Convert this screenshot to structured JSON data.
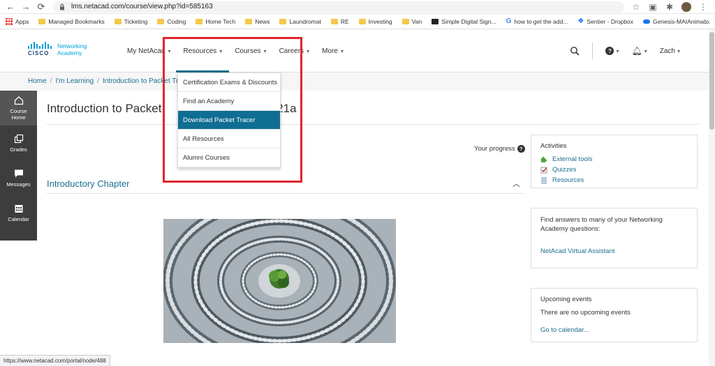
{
  "browser": {
    "url": "lms.netacad.com/course/view.php?id=585163",
    "status_url": "https://www.netacad.com/portal/node/488",
    "bookmarks": [
      {
        "label": "Apps",
        "icon": "apps-grid-icon"
      },
      {
        "label": "Managed Bookmarks",
        "icon": "folder-icon"
      },
      {
        "label": "Ticketing",
        "icon": "folder-icon"
      },
      {
        "label": "Coding",
        "icon": "folder-icon"
      },
      {
        "label": "Home Tech",
        "icon": "folder-icon"
      },
      {
        "label": "News",
        "icon": "folder-icon"
      },
      {
        "label": "Laundromat",
        "icon": "folder-icon"
      },
      {
        "label": "RE",
        "icon": "folder-icon"
      },
      {
        "label": "Investing",
        "icon": "folder-icon"
      },
      {
        "label": "Van",
        "icon": "folder-icon"
      },
      {
        "label": "Simple Digital Sign...",
        "icon": "sign-icon"
      },
      {
        "label": "how to get the add...",
        "icon": "google-icon"
      },
      {
        "label": "Sentier - Dropbox",
        "icon": "dropbox-icon"
      },
      {
        "label": "Genesis-MAIAnimal...",
        "icon": "cloud-icon"
      }
    ],
    "bookmarks_more": "»"
  },
  "header": {
    "logo_text": "CISCO",
    "logo_sub_1": "Networking",
    "logo_sub_2": "Academy",
    "nav": [
      {
        "label": "My NetAcad"
      },
      {
        "label": "Resources"
      },
      {
        "label": "Courses"
      },
      {
        "label": "Careers"
      },
      {
        "label": "More"
      }
    ],
    "user_name": "Zach"
  },
  "breadcrumb": [
    "Home",
    "I'm Learning",
    "Introduction to Packet Tracer"
  ],
  "sidebar": [
    {
      "label_1": "Course",
      "label_2": "Home"
    },
    {
      "label_1": "Grades",
      "label_2": ""
    },
    {
      "label_1": "Messages",
      "label_2": ""
    },
    {
      "label_1": "Calendar",
      "label_2": ""
    }
  ],
  "main": {
    "title_left": "Introduction to Packet ",
    "title_right": "21a",
    "progress_label": "Your progress",
    "section_title": "Introductory Chapter"
  },
  "dropdown": [
    {
      "label": "Certification Exams & Discounts"
    },
    {
      "label": "Find an Academy"
    },
    {
      "label": "Download Packet Tracer"
    },
    {
      "label": "All Resources"
    },
    {
      "label": "Alumni Courses"
    }
  ],
  "blocks": {
    "activities_title": "Activities",
    "activities": [
      {
        "label": "External tools"
      },
      {
        "label": "Quizzes"
      },
      {
        "label": "Resources"
      }
    ],
    "faq_text": "Find answers to many of your Networking Academy questions:",
    "faq_link": "NetAcad Virtual Assistant",
    "events_title": "Upcoming events",
    "events_text": "There are no upcoming events",
    "events_link": "Go to calendar..."
  },
  "colors": {
    "highlight_border": "#e0262c",
    "dropdown_selected": "#0f6e92",
    "link": "#1c6e8f"
  }
}
